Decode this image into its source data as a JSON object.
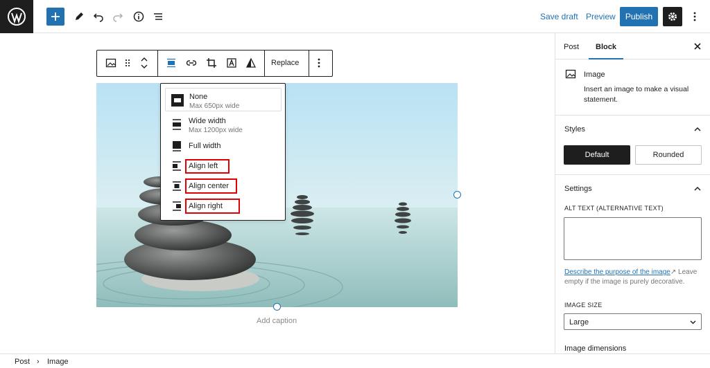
{
  "header": {
    "save_draft": "Save draft",
    "preview": "Preview",
    "publish": "Publish"
  },
  "block_toolbar": {
    "replace": "Replace"
  },
  "alignment_menu": {
    "items": [
      {
        "label": "None",
        "sub": "Max 650px wide",
        "icon": "align-none-icon"
      },
      {
        "label": "Wide width",
        "sub": "Max 1200px wide",
        "icon": "align-wide-icon"
      },
      {
        "label": "Full width",
        "sub": "",
        "icon": "align-full-icon"
      },
      {
        "label": "Align left",
        "sub": "",
        "icon": "align-left-icon"
      },
      {
        "label": "Align center",
        "sub": "",
        "icon": "align-center-icon"
      },
      {
        "label": "Align right",
        "sub": "",
        "icon": "align-right-icon"
      }
    ]
  },
  "image": {
    "caption_placeholder": "Add caption"
  },
  "sidebar": {
    "tabs": [
      "Post",
      "Block"
    ],
    "block_card": {
      "title": "Image",
      "description": "Insert an image to make a visual statement."
    },
    "styles": {
      "heading": "Styles",
      "default": "Default",
      "rounded": "Rounded"
    },
    "settings": {
      "heading": "Settings",
      "alt_label": "ALT TEXT (ALTERNATIVE TEXT)",
      "help_link": "Describe the purpose of the image",
      "help_rest": " Leave empty if the image is purely decorative.",
      "image_size_label": "IMAGE SIZE",
      "image_size_value": "Large",
      "dimensions_label": "Image dimensions"
    }
  },
  "breadcrumb": [
    "Post",
    "Image"
  ],
  "colors": {
    "accent": "#2271b1",
    "dark": "#1e1e1e",
    "highlight": "#e00000"
  }
}
